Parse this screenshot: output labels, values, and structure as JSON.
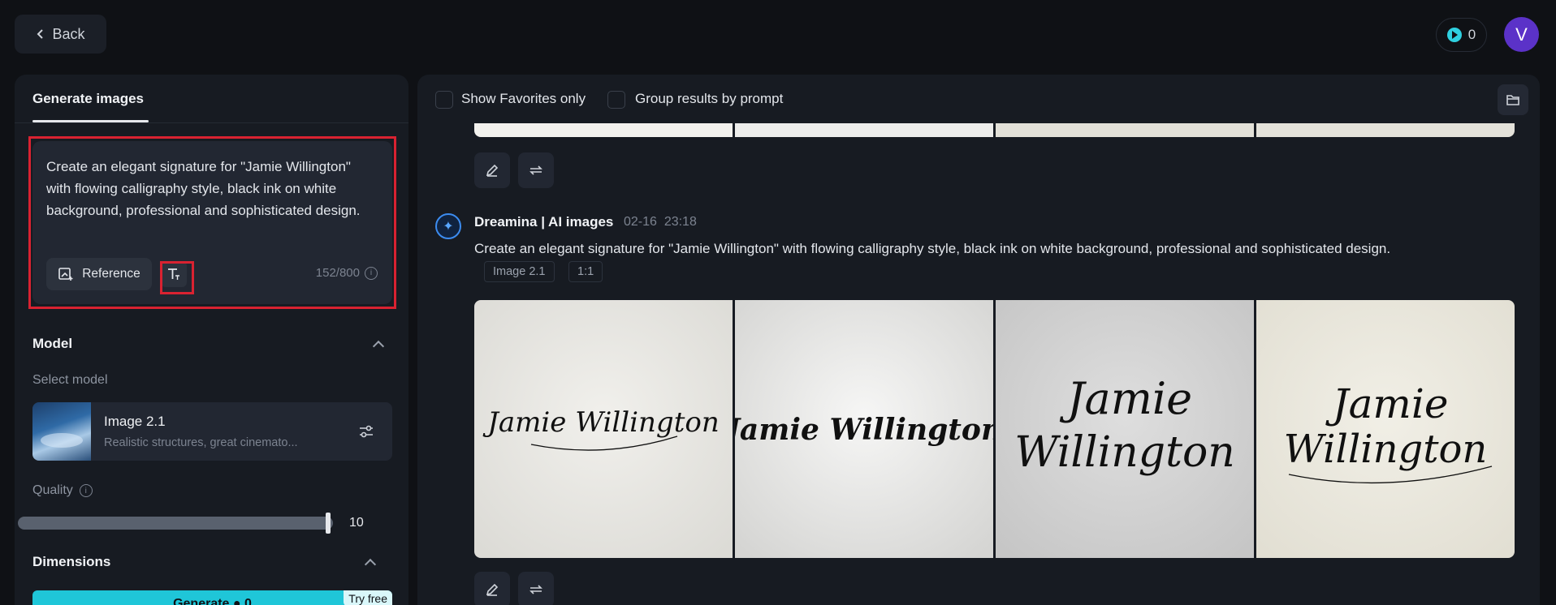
{
  "header": {
    "back_label": "Back",
    "credits_count": "0",
    "avatar_initial": "V"
  },
  "left_panel": {
    "tab_label": "Generate images",
    "prompt_text": "Create an elegant signature for \"Jamie Willington\" with flowing calligraphy style, black ink on white background, professional and sophisticated design.",
    "reference_label": "Reference",
    "char_count": "152/800",
    "model_section_title": "Model",
    "select_model_label": "Select model",
    "model_name": "Image 2.1",
    "model_desc": "Realistic structures, great cinemato...",
    "quality_label": "Quality",
    "quality_value": "10",
    "quality_fraction": 1.0,
    "dimensions_title": "Dimensions",
    "generate_label": "Generate",
    "generate_cost": "0",
    "try_free_label": "Try free"
  },
  "right_panel": {
    "show_favorites_label": "Show Favorites only",
    "group_results_label": "Group results by prompt",
    "generation": {
      "source": "Dreamina | AI images",
      "date": "02-16",
      "time": "23:18",
      "prompt": "Create an elegant signature for \"Jamie Willington\" with flowing calligraphy style, black ink on white background, professional and sophisticated design.",
      "tags": [
        "Image 2.1",
        "1:1"
      ],
      "images": [
        {
          "line1": "Jamie Willington",
          "line2": ""
        },
        {
          "line1": "Jamie Willington",
          "line2": ""
        },
        {
          "line1": "Jamie",
          "line2": "Willington"
        },
        {
          "line1": "Jamie",
          "line2": "Willington"
        }
      ]
    }
  },
  "icons": [
    "chevron-left-icon",
    "credit-play-icon",
    "reference-image-icon",
    "text-tool-icon",
    "info-icon",
    "chevron-up-icon",
    "adjust-sliders-icon",
    "folder-icon",
    "edit-pencil-icon",
    "regenerate-icon",
    "dreamina-logo-icon"
  ],
  "colors": {
    "accent": "#1fc6d8",
    "highlight": "#d92231",
    "avatar": "#5b32c8",
    "panel": "#171b22",
    "background": "#0f1115"
  }
}
